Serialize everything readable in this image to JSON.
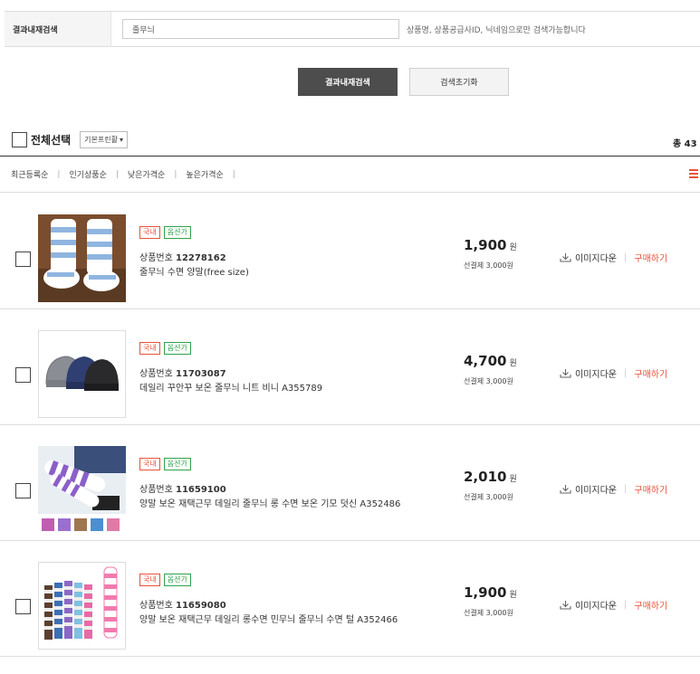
{
  "search": {
    "label": "결과내재검색",
    "value": "줄무늬",
    "hint": "상품명, 상품공급사ID, 닉네임으로만 검색가능합니다"
  },
  "buttons": {
    "search": "결과내재검색",
    "reset": "검색초기화"
  },
  "toolbar": {
    "select_all": "전체선택",
    "dropdown": "기본프린활",
    "total": "총 43"
  },
  "sort": [
    "최근등록순",
    "인기상품순",
    "낮은가격순",
    "높은가격순"
  ],
  "common": {
    "badge_domestic": "국내",
    "badge_option": "옵션가",
    "pno_label": "상품번호",
    "currency": "원",
    "download": "이미지다운",
    "buy": "구매하기"
  },
  "products": [
    {
      "number": "12278162",
      "name": "줄무늬 수면 양말(free size)",
      "price": "1,900",
      "shipping": "선결제 3,000원"
    },
    {
      "number": "11703087",
      "name": "데일리 꾸안꾸 보온 줄무늬 니트 비니 A355789",
      "price": "4,700",
      "shipping": "선결제 3,000원"
    },
    {
      "number": "11659100",
      "name": "양말 보온 재택근무 데일리 줄무늬 롱 수면 보온 기모 덧신 A352486",
      "price": "2,010",
      "shipping": "선결제 3,000원"
    },
    {
      "number": "11659080",
      "name": "양말 보온 재택근무 데일리 롱수면 민무늬 줄무늬 수면 털 A352466",
      "price": "1,900",
      "shipping": "선결제 3,000원"
    }
  ],
  "colors": {
    "accent": "#e8533a",
    "option_green": "#2fa24a",
    "dark_button": "#4d4d4d"
  }
}
